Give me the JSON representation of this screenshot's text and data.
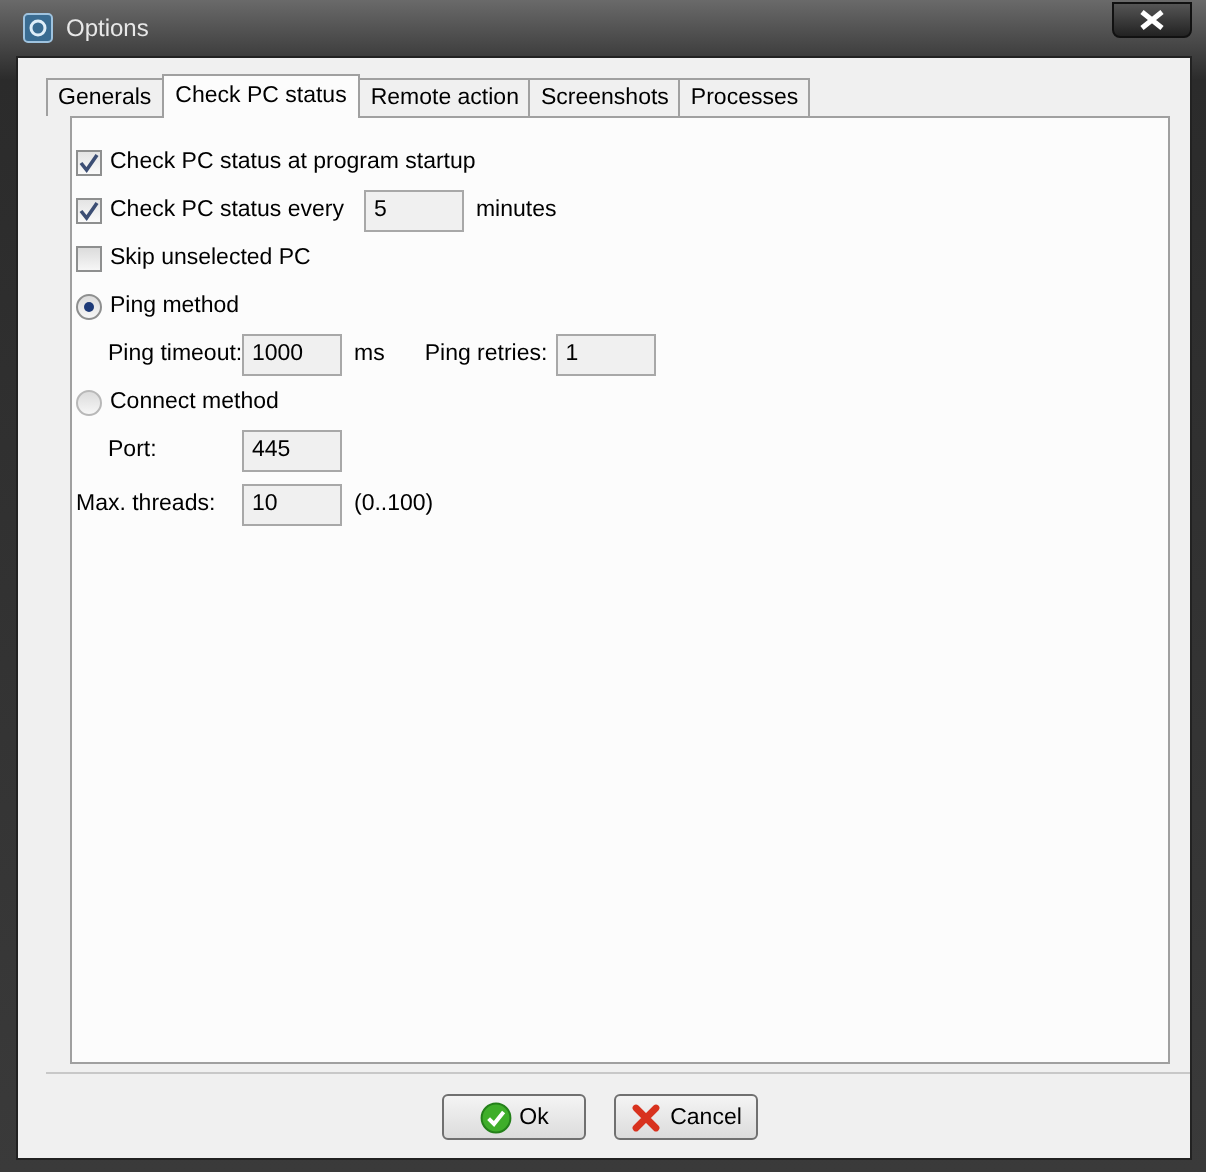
{
  "window": {
    "title": "Options"
  },
  "tabs": [
    {
      "label": "Generals",
      "selected": false
    },
    {
      "label": "Check PC status",
      "selected": true
    },
    {
      "label": "Remote action",
      "selected": false
    },
    {
      "label": "Screenshots",
      "selected": false
    },
    {
      "label": "Processes",
      "selected": false
    }
  ],
  "options": [
    {
      "kind": "checkbox",
      "label": "Check PC status at program startup",
      "checked": true
    },
    {
      "kind": "checkbox",
      "label": "Check PC status every",
      "checked": true,
      "value": "5",
      "unit": "minutes"
    },
    {
      "kind": "checkbox",
      "label": "Skip unselected PC",
      "checked": false
    },
    {
      "kind": "radio",
      "label": "Ping method",
      "selected": true
    },
    {
      "kind": "fields",
      "fields": [
        {
          "label": "Ping timeout:",
          "value": "1000",
          "unit": "ms"
        },
        {
          "label": "Ping retries:",
          "value": "1"
        }
      ]
    },
    {
      "kind": "radio",
      "label": "Connect method",
      "selected": false
    },
    {
      "kind": "fields",
      "fields": [
        {
          "label": "Port:",
          "value": "445"
        }
      ]
    },
    {
      "kind": "field",
      "label": "Max. threads:",
      "value": "10",
      "unit": "(0..100)"
    }
  ],
  "buttons": [
    {
      "kind": "ok",
      "label": "Ok"
    },
    {
      "kind": "cancel",
      "label": "Cancel"
    }
  ]
}
